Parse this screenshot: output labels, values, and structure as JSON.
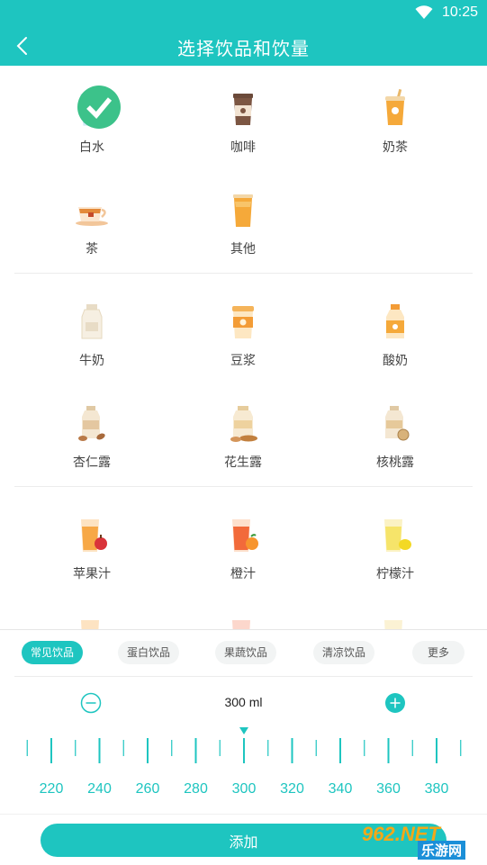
{
  "status_bar": {
    "time": "10:25"
  },
  "header": {
    "title": "选择饮品和饮量"
  },
  "colors": {
    "accent": "#1ec5c0",
    "check": "#3cc28a"
  },
  "drinks": [
    {
      "label": "白水",
      "icon": "water-glass-icon",
      "selected": true
    },
    {
      "label": "咖啡",
      "icon": "coffee-cup-icon"
    },
    {
      "label": "奶茶",
      "icon": "milk-tea-icon"
    },
    {
      "label": "茶",
      "icon": "tea-cup-icon"
    },
    {
      "label": "其他",
      "icon": "other-drink-icon"
    },
    {
      "label": "牛奶",
      "icon": "milk-bottle-icon"
    },
    {
      "label": "豆浆",
      "icon": "soy-milk-icon"
    },
    {
      "label": "酸奶",
      "icon": "yogurt-bottle-icon"
    },
    {
      "label": "杏仁露",
      "icon": "almond-drink-icon"
    },
    {
      "label": "花生露",
      "icon": "peanut-drink-icon"
    },
    {
      "label": "核桃露",
      "icon": "walnut-drink-icon"
    },
    {
      "label": "苹果汁",
      "icon": "apple-juice-icon"
    },
    {
      "label": "橙汁",
      "icon": "orange-juice-icon"
    },
    {
      "label": "柠檬汁",
      "icon": "lemon-juice-icon"
    }
  ],
  "tabs": [
    {
      "label": "常见饮品",
      "active": true
    },
    {
      "label": "蛋白饮品"
    },
    {
      "label": "果蔬饮品"
    },
    {
      "label": "清凉饮品"
    },
    {
      "label": "更多"
    }
  ],
  "amount": {
    "value": "300 ml"
  },
  "ruler": {
    "labels": [
      "220",
      "240",
      "260",
      "280",
      "300",
      "320",
      "340",
      "360",
      "380"
    ],
    "selected": 300
  },
  "add_button": {
    "label": "添加"
  },
  "watermark": {
    "text1": "962.NET",
    "text2": "乐游网"
  }
}
